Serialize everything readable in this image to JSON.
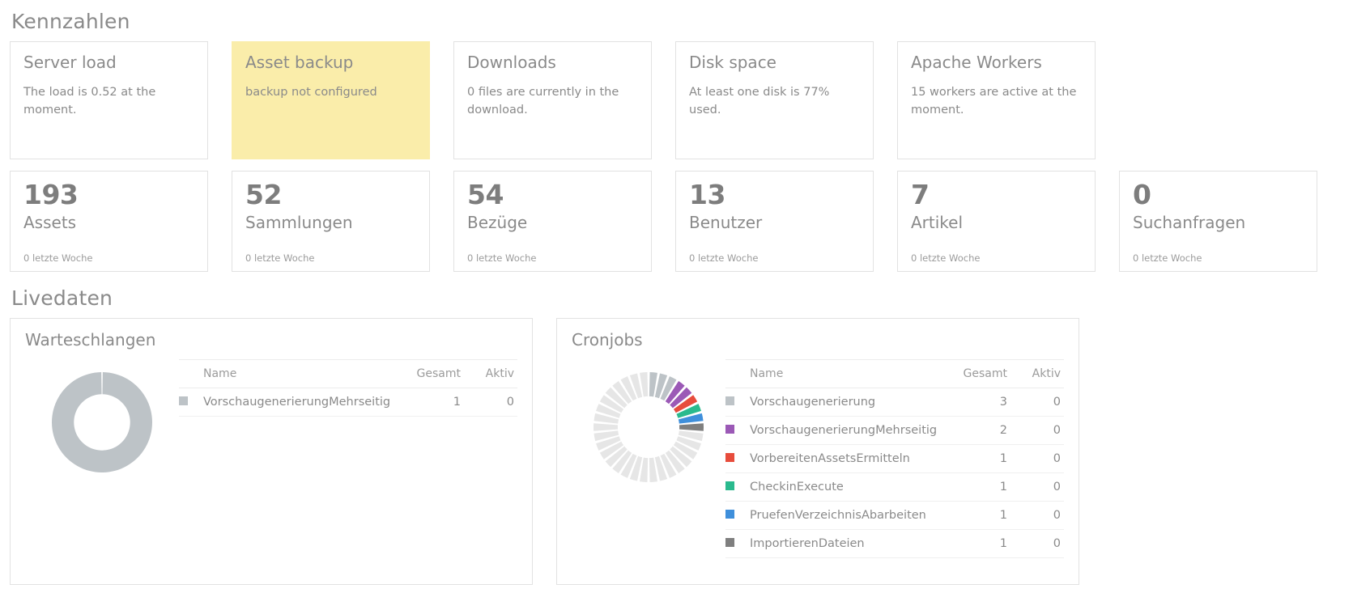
{
  "sections": {
    "kennzahlen_title": "Kennzahlen",
    "livedaten_title": "Livedaten"
  },
  "status_cards": [
    {
      "title": "Server load",
      "desc": "The load is 0.52 at the moment.",
      "highlight": false
    },
    {
      "title": "Asset backup",
      "desc": "backup not configured",
      "highlight": true
    },
    {
      "title": "Downloads",
      "desc": "0 files are currently in the download.",
      "highlight": false
    },
    {
      "title": "Disk space",
      "desc": "At least one disk is 77% used.",
      "highlight": false
    },
    {
      "title": "Apache Workers",
      "desc": "15 workers are active at the moment.",
      "highlight": false
    }
  ],
  "stat_cards": [
    {
      "number": "193",
      "label": "Assets",
      "sub": "0 letzte Woche"
    },
    {
      "number": "52",
      "label": "Sammlungen",
      "sub": "0 letzte Woche"
    },
    {
      "number": "54",
      "label": "Bezüge",
      "sub": "0 letzte Woche"
    },
    {
      "number": "13",
      "label": "Benutzer",
      "sub": "0 letzte Woche"
    },
    {
      "number": "7",
      "label": "Artikel",
      "sub": "0 letzte Woche"
    },
    {
      "number": "0",
      "label": "Suchanfragen",
      "sub": "0 letzte Woche"
    }
  ],
  "queues_panel": {
    "title": "Warteschlangen",
    "columns": {
      "name": "Name",
      "total": "Gesamt",
      "active": "Aktiv"
    },
    "rows": [
      {
        "name": "VorschaugenerierungMehrseitig",
        "total": "1",
        "active": "0",
        "color": "#bdc3c7"
      }
    ]
  },
  "cronjobs_panel": {
    "title": "Cronjobs",
    "columns": {
      "name": "Name",
      "total": "Gesamt",
      "active": "Aktiv"
    },
    "rows": [
      {
        "name": "Vorschaugenerierung",
        "total": "3",
        "active": "0",
        "color": "#bdc3c7"
      },
      {
        "name": "VorschaugenerierungMehrseitig",
        "total": "2",
        "active": "0",
        "color": "#9b59b6"
      },
      {
        "name": "VorbereitenAssetsErmitteln",
        "total": "1",
        "active": "0",
        "color": "#e74c3c"
      },
      {
        "name": "CheckinExecute",
        "total": "1",
        "active": "0",
        "color": "#2aba8e"
      },
      {
        "name": "PruefenVerzeichnisAbarbeiten",
        "total": "1",
        "active": "0",
        "color": "#3f8fdb"
      },
      {
        "name": "ImportierenDateien",
        "total": "1",
        "active": "0",
        "color": "#7f7f7f"
      }
    ]
  },
  "chart_data": [
    {
      "type": "pie",
      "title": "Warteschlangen",
      "labels": [
        "VorschaugenerierungMehrseitig"
      ],
      "values": [
        1
      ],
      "colors": [
        "#bdc3c7"
      ],
      "empty_slots": 0,
      "empty_color": "#e6e6e6",
      "donut": true,
      "legend": "right"
    },
    {
      "type": "pie",
      "title": "Cronjobs",
      "labels": [
        "Vorschaugenerierung",
        "VorschaugenerierungMehrseitig",
        "VorbereitenAssetsErmitteln",
        "CheckinExecute",
        "PruefenVerzeichnisAbarbeiten",
        "ImportierenDateien"
      ],
      "values": [
        3,
        2,
        1,
        1,
        1,
        1
      ],
      "colors": [
        "#bdc3c7",
        "#9b59b6",
        "#e74c3c",
        "#2aba8e",
        "#3f8fdb",
        "#7f7f7f"
      ],
      "empty_slots": 25,
      "empty_color": "#e6e6e6",
      "donut": true,
      "legend": "right"
    }
  ]
}
